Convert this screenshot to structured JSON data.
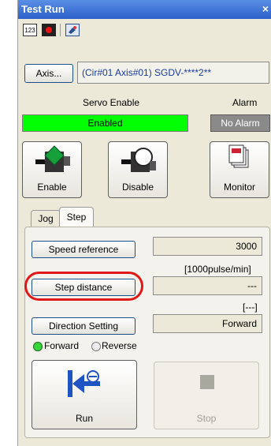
{
  "window": {
    "title": "Test Run",
    "close_glyph": "×"
  },
  "toolbar": {
    "icons": [
      "calendar-123-icon",
      "record-icon",
      "settings-icon"
    ],
    "calendar_text": "123"
  },
  "axis": {
    "button_label": "Axis...",
    "value": "(Cir#01 Axis#01) SGDV-****2**"
  },
  "status": {
    "servo_enable_label": "Servo Enable",
    "alarm_label": "Alarm",
    "servo_state": "Enabled",
    "alarm_state": "No Alarm",
    "servo_color": "#00ff00",
    "alarm_color": "#8a8a8a"
  },
  "actions": {
    "enable": "Enable",
    "disable": "Disable",
    "monitor": "Monitor"
  },
  "tabs": [
    {
      "label": "Jog"
    },
    {
      "label": "Step"
    }
  ],
  "step": {
    "speed_reference_button": "Speed reference",
    "speed_value": "3000",
    "speed_unit": "[1000pulse/min]",
    "step_distance_button": "Step distance",
    "step_distance_value": "---",
    "step_distance_unit": "[---]",
    "direction_button": "Direction Setting",
    "direction_value": "Forward",
    "forward_label": "Forward",
    "reverse_label": "Reverse",
    "run_label": "Run",
    "stop_label": "Stop"
  }
}
